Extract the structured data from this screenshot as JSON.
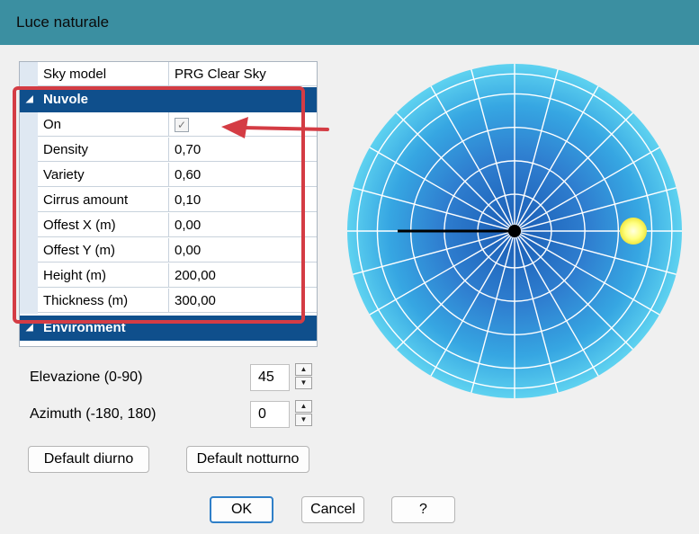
{
  "window": {
    "title": "Luce naturale"
  },
  "grid": {
    "sky_model": {
      "name": "Sky model",
      "value": "PRG Clear Sky"
    },
    "nuvole": {
      "title": "Nuvole",
      "on_label": "On",
      "on_checked": true,
      "rows": [
        {
          "name": "Density",
          "value": "0,70"
        },
        {
          "name": "Variety",
          "value": "0,60"
        },
        {
          "name": "Cirrus amount",
          "value": "0,10"
        },
        {
          "name": "Offest X (m)",
          "value": "0,00"
        },
        {
          "name": "Offest Y (m)",
          "value": "0,00"
        },
        {
          "name": "Height (m)",
          "value": "200,00"
        },
        {
          "name": "Thickness (m)",
          "value": "300,00"
        }
      ]
    },
    "environment": {
      "title": "Environment"
    }
  },
  "elevation": {
    "label": "Elevazione (0-90)",
    "value": "45"
  },
  "azimuth": {
    "label": "Azimuth (-180, 180)",
    "value": "0"
  },
  "buttons": {
    "default_day": "Default diurno",
    "default_night": "Default notturno",
    "ok": "OK",
    "cancel": "Cancel",
    "help": "?"
  },
  "colors": {
    "titlebar": "#3b8fa1",
    "category": "#0f4f8c",
    "highlight": "#d43c44",
    "sky_outer": "#5ed2f0",
    "sky_inner": "#1a5cb4",
    "sun": "#ffff80"
  },
  "sky": {
    "sun_azimuth_deg": 0,
    "sun_elevation_deg": 45
  }
}
